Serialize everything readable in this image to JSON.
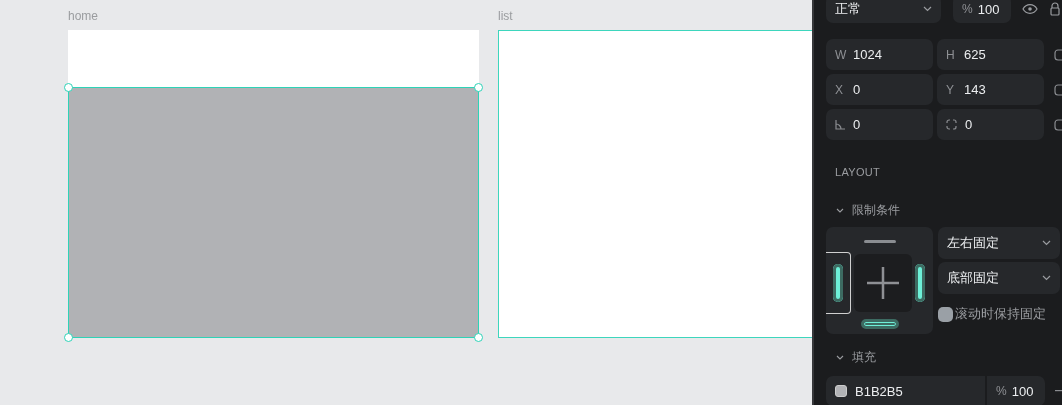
{
  "canvas": {
    "frames": [
      {
        "label": "home",
        "highlighted": false,
        "layer": {
          "selected": true
        }
      },
      {
        "label": "list",
        "highlighted": true
      }
    ]
  },
  "panel": {
    "blend_mode": "正常",
    "opacity": {
      "symbol": "%",
      "value": "100"
    },
    "visible": true,
    "geometry": [
      {
        "kind": "text",
        "label": "W",
        "value": "1024"
      },
      {
        "kind": "text",
        "label": "H",
        "value": "625"
      },
      {
        "kind": "text",
        "label": "X",
        "value": "0"
      },
      {
        "kind": "text",
        "label": "Y",
        "value": "143"
      },
      {
        "kind": "rotation",
        "value": "0"
      },
      {
        "kind": "radius",
        "value": "0"
      }
    ],
    "layout": {
      "title": "LAYOUT"
    },
    "constraints": {
      "title": "限制条件",
      "expanded": true,
      "top": false,
      "left": true,
      "right": true,
      "bottom": true,
      "horizontal": "左右固定",
      "vertical": "底部固定",
      "keep_on_scroll": {
        "label": "滚动时保持固定",
        "checked": false
      }
    },
    "fill": {
      "title": "填充",
      "expanded": true,
      "hex": "B1B2B5",
      "opacity_symbol": "%",
      "opacity": "100"
    }
  }
}
